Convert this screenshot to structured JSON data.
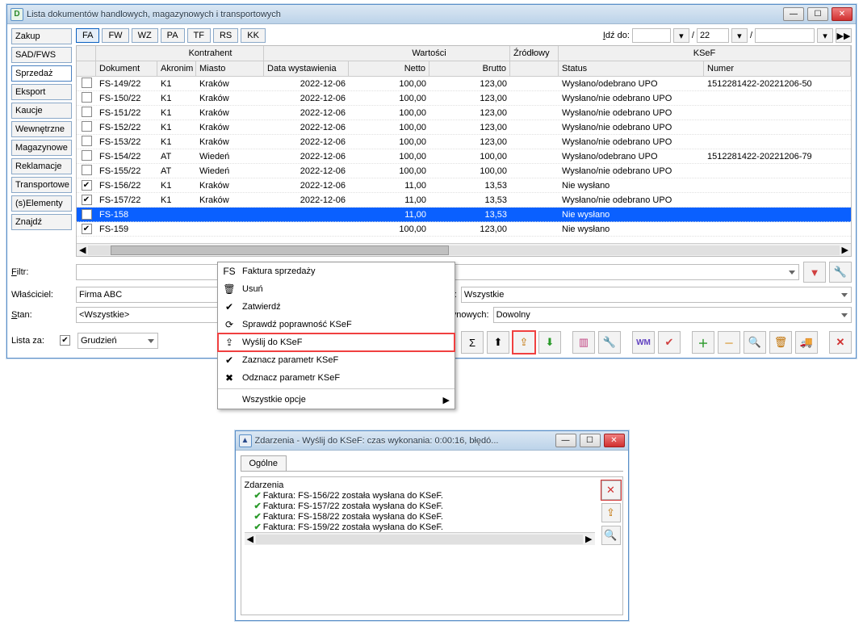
{
  "window1": {
    "title": "Lista dokumentów handlowych, magazynowych i transportowych"
  },
  "leftnav": [
    "Zakup",
    "SAD/FWS",
    "Sprzedaż",
    "Eksport",
    "Kaucje",
    "Wewnętrzne",
    "Magazynowe",
    "Reklamacje",
    "Transportowe",
    "(s)Elementy",
    "Znajdź"
  ],
  "tabs": [
    "FA",
    "FW",
    "WZ",
    "PA",
    "TF",
    "RS",
    "KK"
  ],
  "gobar": {
    "label": "Idź do:",
    "page": "22",
    "slash": "/"
  },
  "columns_group": {
    "dokument": "Dokument",
    "kontrahent": "Kontrahent",
    "data": "Data wystawienia",
    "wartosci": "Wartości",
    "zrod": "Źródłowy",
    "ksef": "KSeF"
  },
  "columns_sub": {
    "akr": "Akronim",
    "mia": "Miasto",
    "net": "Netto",
    "bru": "Brutto",
    "stat": "Status",
    "num": "Numer"
  },
  "rows": [
    {
      "chk": false,
      "dok": "FS-149/22",
      "akr": "K1",
      "mia": "Kraków",
      "dat": "2022-12-06",
      "net": "100,00",
      "bru": "123,00",
      "stat": "Wysłano/odebrano UPO",
      "num": "1512281422-20221206-50"
    },
    {
      "chk": false,
      "dok": "FS-150/22",
      "akr": "K1",
      "mia": "Kraków",
      "dat": "2022-12-06",
      "net": "100,00",
      "bru": "123,00",
      "stat": "Wysłano/nie odebrano UPO",
      "num": ""
    },
    {
      "chk": false,
      "dok": "FS-151/22",
      "akr": "K1",
      "mia": "Kraków",
      "dat": "2022-12-06",
      "net": "100,00",
      "bru": "123,00",
      "stat": "Wysłano/nie odebrano UPO",
      "num": ""
    },
    {
      "chk": false,
      "dok": "FS-152/22",
      "akr": "K1",
      "mia": "Kraków",
      "dat": "2022-12-06",
      "net": "100,00",
      "bru": "123,00",
      "stat": "Wysłano/nie odebrano UPO",
      "num": ""
    },
    {
      "chk": false,
      "dok": "FS-153/22",
      "akr": "K1",
      "mia": "Kraków",
      "dat": "2022-12-06",
      "net": "100,00",
      "bru": "123,00",
      "stat": "Wysłano/nie odebrano UPO",
      "num": ""
    },
    {
      "chk": false,
      "dok": "FS-154/22",
      "akr": "AT",
      "mia": "Wiedeń",
      "dat": "2022-12-06",
      "net": "100,00",
      "bru": "100,00",
      "stat": "Wysłano/odebrano UPO",
      "num": "1512281422-20221206-79"
    },
    {
      "chk": false,
      "dok": "FS-155/22",
      "akr": "AT",
      "mia": "Wiedeń",
      "dat": "2022-12-06",
      "net": "100,00",
      "bru": "100,00",
      "stat": "Wysłano/nie odebrano UPO",
      "num": ""
    },
    {
      "chk": true,
      "dok": "FS-156/22",
      "akr": "K1",
      "mia": "Kraków",
      "dat": "2022-12-06",
      "net": "11,00",
      "bru": "13,53",
      "stat": "Nie wysłano",
      "num": ""
    },
    {
      "chk": true,
      "dok": "FS-157/22",
      "akr": "K1",
      "mia": "Kraków",
      "dat": "2022-12-06",
      "net": "11,00",
      "bru": "13,53",
      "stat": "Wysłano/nie odebrano UPO",
      "num": ""
    },
    {
      "chk": true,
      "dok": "FS-158",
      "akr": "",
      "mia": "",
      "dat": "",
      "net": "11,00",
      "bru": "13,53",
      "stat": "Nie wysłano",
      "num": "",
      "sel": true
    },
    {
      "chk": true,
      "dok": "FS-159",
      "akr": "",
      "mia": "",
      "dat": "",
      "net": "100,00",
      "bru": "123,00",
      "stat": "Nie wysłano",
      "num": ""
    }
  ],
  "context_menu": {
    "items": [
      {
        "icon": "FS",
        "label": "Faktura sprzedaży",
        "cls": ""
      },
      {
        "icon": "🗑",
        "label": "Usuń",
        "cls": ""
      },
      {
        "icon": "✔",
        "label": "Zatwierdź",
        "cls": ""
      },
      {
        "icon": "⟳",
        "label": "Sprawdź poprawność KSeF",
        "cls": ""
      },
      {
        "icon": "⇪",
        "label": "Wyślij do KSeF",
        "cls": "highlight"
      },
      {
        "icon": "✔",
        "label": "Zaznacz parametr KSeF",
        "cls": ""
      },
      {
        "icon": "✖",
        "label": "Odznacz parametr KSeF",
        "cls": ""
      }
    ],
    "all": "Wszystkie opcje"
  },
  "filters": {
    "filtr": "Filtr:",
    "wlasciciel": "Właściciel:",
    "wlasciciel_val": "Firma ABC",
    "stan": "Stan:",
    "stan_val": "<Wszystkie>",
    "listaza": "Lista za:",
    "listaza_val": "Grudzień",
    "statusksef": "Status KSeF:",
    "statusksef_val": "Wszystkie",
    "stanmag": "Stan magazynowych:",
    "stanmag_val": "Dowolny"
  },
  "window2": {
    "title": "Zdarzenia - Wyślij do KSeF: czas wykonania:  0:00:16, błędó...",
    "tab": "Ogólne",
    "root": "Zdarzenia",
    "events": [
      "Faktura: FS-156/22 została wysłana do KSeF.",
      "Faktura: FS-157/22 została wysłana do KSeF.",
      "Faktura: FS-158/22 została wysłana do KSeF.",
      "Faktura: FS-159/22 została wysłana do KSeF."
    ]
  }
}
